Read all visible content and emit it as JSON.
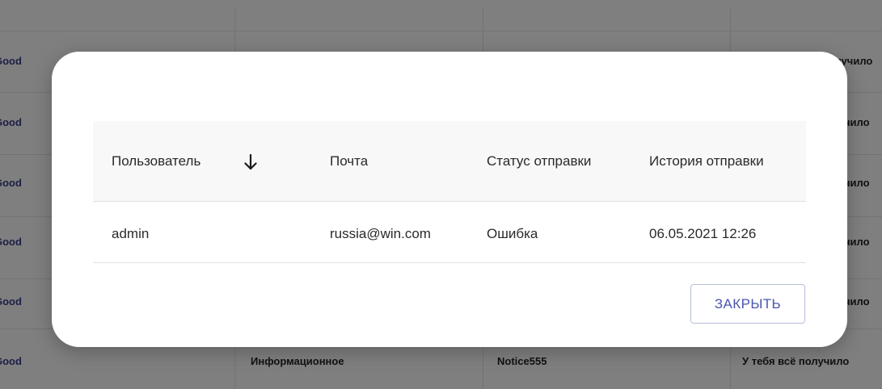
{
  "background_table": {
    "status_label": "Good",
    "partial_text_rows": [
      "получило",
      "чило",
      "чило",
      "чило",
      "чило"
    ],
    "last_row": {
      "status": "Good",
      "type": "Информационное",
      "name": "Notice555",
      "message": "У тебя всё получило"
    }
  },
  "dialog": {
    "columns": {
      "user": "Пользователь",
      "email": "Почта",
      "status": "Статус отправки",
      "history": "История отправки"
    },
    "sort_icon": "arrow-down-icon",
    "rows": [
      {
        "user": "admin",
        "email": "russia@win.com",
        "status": "Ошибка",
        "history": "06.05.2021 12:26"
      }
    ],
    "close_label": "ЗАКРЫТЬ"
  },
  "colors": {
    "accent": "#4a55b0",
    "status_text": "#3b3f8c",
    "overlay": "rgba(0,0,0,0.5)"
  }
}
